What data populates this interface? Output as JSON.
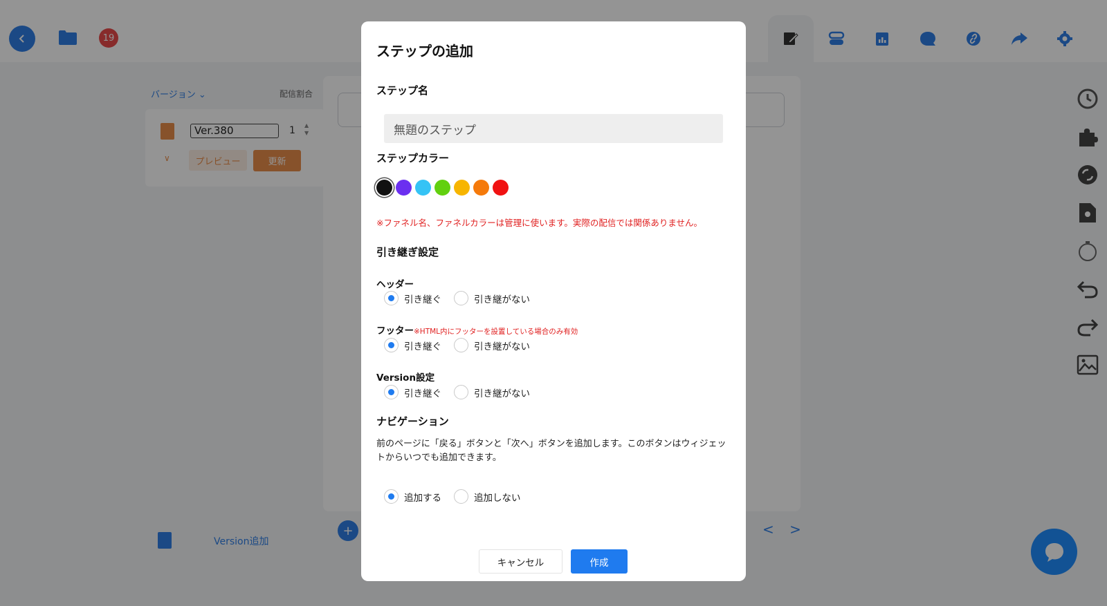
{
  "background": {
    "badge_count": "19",
    "version_header_label": "バージョン",
    "version_header_right": "配信割合",
    "version_name": "Ver.380",
    "version_ratio": "1",
    "preview_label": "プレビュー",
    "update_label": "更新",
    "version_add_label": "Version追加",
    "nav_arrows": "< >",
    "icons": {
      "back": "chevron-left-icon",
      "folder": "folder-icon",
      "top_tools": [
        "edit-page-icon",
        "toggle-icon",
        "chart-icon",
        "chat-bubble-icon",
        "link-icon",
        "share-icon",
        "gear-icon"
      ],
      "side_tools": [
        "history-icon",
        "puzzle-icon",
        "sync-icon",
        "file-settings-icon",
        "stopwatch-icon",
        "undo-icon",
        "redo-icon",
        "image-upload-icon"
      ]
    },
    "colors": {
      "accent": "#2f7fe5",
      "orange": "#e98d4a",
      "badge": "#e94b4b",
      "fab": "#1f8dff"
    }
  },
  "modal": {
    "title": "ステップの追加",
    "step_name_label": "ステップ名",
    "step_name_value": "無題のステップ",
    "step_color_label": "ステップカラー",
    "color_options": [
      "#111111",
      "#6b2ff0",
      "#35c3f5",
      "#62d00f",
      "#f7b500",
      "#f57a0b",
      "#f01212"
    ],
    "selected_color_index": 0,
    "color_note": "※ファネル名、ファネルカラーは管理に使います。実際の配信では関係ありません。",
    "inherit_title": "引き継ぎ設定",
    "header_label": "ヘッダー",
    "footer_label": "フッター",
    "footer_note": "※HTML内にフッターを設置している場合のみ有効",
    "version_label": "Version設定",
    "inherit_on": "引き継ぐ",
    "inherit_off": "引き継がない",
    "navigation_title": "ナビゲーション",
    "navigation_desc": "前のページに「戻る」ボタンと「次へ」ボタンを追加します。このボタンはウィジェットからいつでも追加できます。",
    "add_on": "追加する",
    "add_off": "追加しない",
    "cancel_label": "キャンセル",
    "create_label": "作成",
    "accent_color": "#1f7bef",
    "note_color": "#e02020"
  }
}
